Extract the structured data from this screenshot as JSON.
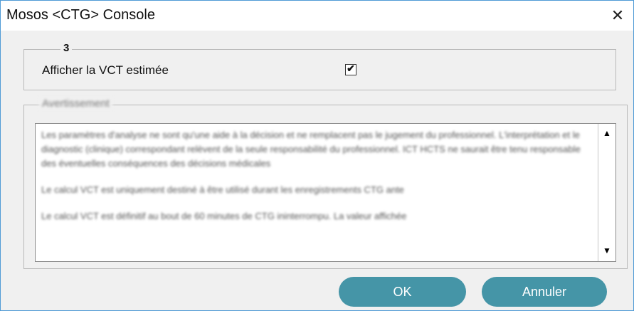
{
  "window": {
    "title": "Mosos <CTG> Console",
    "close_glyph": "✕"
  },
  "options_group": {
    "legend": "3",
    "checkbox_label": "Afficher la VCT estimée",
    "checkbox_checked": true,
    "check_glyph": "✔"
  },
  "warning_group": {
    "legend": "Avertissement",
    "paragraphs": [
      "Les paramètres d'analyse ne sont qu'une aide à la décision et ne remplacent pas le jugement du professionnel. L'interprétation et le diagnostic (clinique) correspondant relèvent de la seule responsabilité du professionnel. ICT HCTS ne saurait être tenu responsable des éventuelles conséquences des décisions médicales",
      "Le calcul VCT est uniquement destiné à être utilisé durant les enregistrements CTG ante",
      "Le calcul VCT est définitif au bout de 60 minutes de CTG ininterrompu. La valeur affichée"
    ],
    "scroll_up_glyph": "▲",
    "scroll_down_glyph": "▼"
  },
  "buttons": {
    "ok": "OK",
    "cancel": "Annuler"
  },
  "colors": {
    "window_border": "#4f9bd6",
    "button_bg": "#4595a7",
    "dialog_bg": "#f0f0f0"
  }
}
